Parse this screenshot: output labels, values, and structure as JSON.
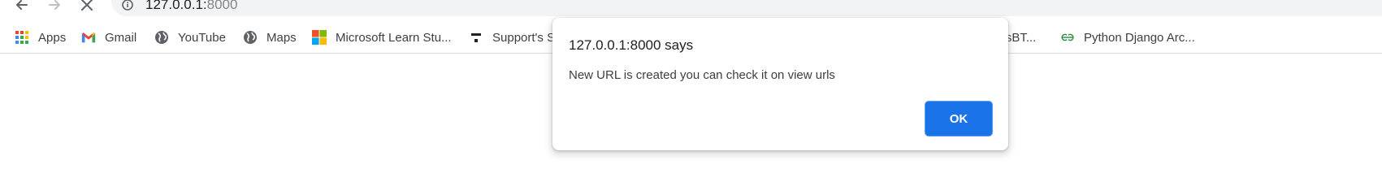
{
  "browser": {
    "url_host": "127.0.0.1:",
    "url_port": "8000"
  },
  "bookmarks": [
    {
      "label": "Apps",
      "icon": "apps-grid-icon"
    },
    {
      "label": "Gmail",
      "icon": "gmail-icon"
    },
    {
      "label": "YouTube",
      "icon": "globe-icon"
    },
    {
      "label": "Maps",
      "icon": "globe-icon"
    },
    {
      "label": "Microsoft Learn Stu...",
      "icon": "microsoft-icon"
    },
    {
      "label": "Support's S",
      "icon": "support-icon"
    },
    {
      "label": "ntisBT...",
      "icon": "hidden"
    },
    {
      "label": "Python Django Arc...",
      "icon": "geeksforgeeks-icon"
    }
  ],
  "dialog": {
    "title": "127.0.0.1:8000 says",
    "message": "New URL is created you can check it on view urls",
    "ok_label": "OK"
  },
  "colors": {
    "accent": "#1a73e8",
    "omnibox_bg": "#f1f3f4",
    "text": "#202124"
  }
}
